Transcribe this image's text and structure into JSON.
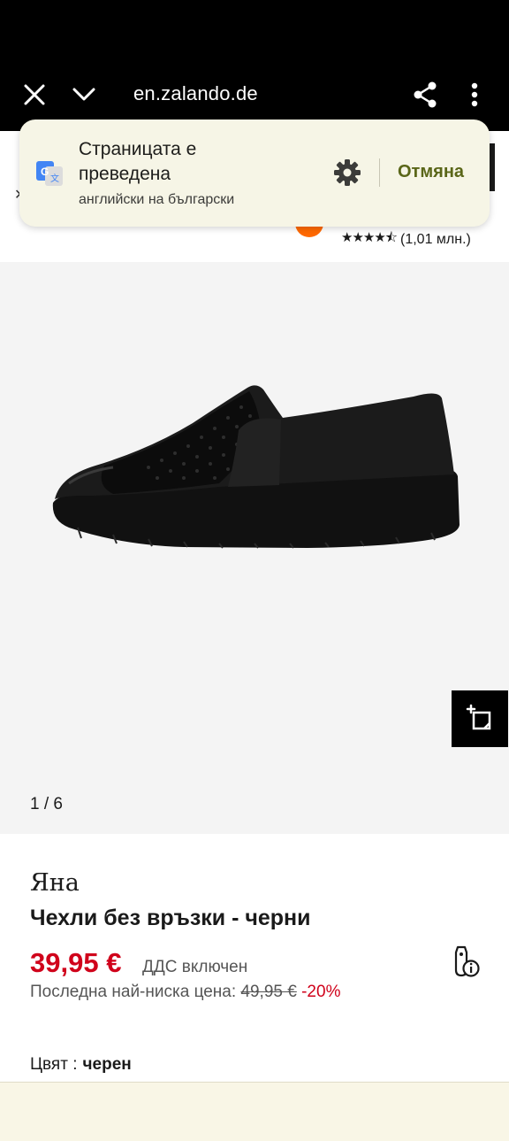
{
  "browser": {
    "url": "en.zalando.de"
  },
  "translate_popup": {
    "title": "Страницата е преведена",
    "subtitle": "английски на български",
    "cancel_label": "Отмяна"
  },
  "header": {
    "rating_stars": 4.5,
    "rating_count": "(1,01 млн.)"
  },
  "gallery": {
    "counter": "1 / 6"
  },
  "product": {
    "brand": "Яна",
    "name": "Чехли без връзки - черни",
    "price": "39,95 €",
    "vat_note": "ДДС включен",
    "lowest_price_label": "Последна най-ниска цена:",
    "old_price": "49,95 €",
    "discount": "-20%",
    "color_label": "Цвят :",
    "color_value": "черен"
  },
  "colors": {
    "accent_price": "#d0021b",
    "popup_bg": "#f6f5e6",
    "cancel_text": "#5a6618",
    "brand_orange": "#ff6900"
  },
  "icons": [
    "close-icon",
    "chevron-down-icon",
    "share-icon",
    "more-vert-icon",
    "google-translate-icon",
    "gear-icon",
    "ar-view-icon",
    "price-info-icon",
    "star-icon"
  ]
}
